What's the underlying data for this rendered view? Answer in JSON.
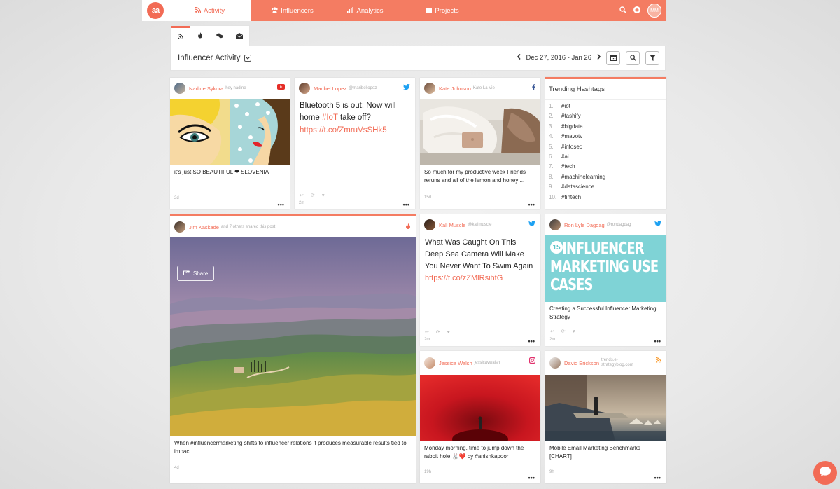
{
  "nav": {
    "logo": "aa",
    "tabs": [
      {
        "label": "Activity",
        "icon": "rss-icon"
      },
      {
        "label": "Influencers",
        "icon": "users-icon"
      },
      {
        "label": "Analytics",
        "icon": "bar-chart-icon"
      },
      {
        "label": "Projects",
        "icon": "folder-icon"
      }
    ],
    "user_initials": "MM"
  },
  "subtabs": [
    "rss-icon",
    "fire-icon",
    "comments-icon",
    "envelope-icon"
  ],
  "header": {
    "title": "Influencer Activity",
    "date_range": "Dec 27, 2016 - Jan 26"
  },
  "cards": {
    "nadine": {
      "name": "Nadine Sykora",
      "handle": "hey nadine",
      "caption": "it's just SO BEAUTIFUL ❤ SLOVENIA",
      "time": "2d"
    },
    "maribel": {
      "name": "Maribel Lopez",
      "handle": "@maribellopez",
      "text": "Bluetooth 5 is out: Now will home ",
      "hashtag": "#IoT",
      "text2": " take off?",
      "link": "https://t.co/ZmruVsSHk5",
      "time": "2m"
    },
    "kate": {
      "name": "Kate Johnson",
      "handle": "Kate La Vie",
      "caption": "So much for my productive week Friends reruns and all of the lemon and honey ...",
      "time": "15d"
    },
    "jim": {
      "name": "Jim Kaskade",
      "handle": "and 7 others shared this post",
      "share": "Share",
      "caption": "When #influencermarketing shifts to influencer relations it produces measurable results tied to impact",
      "time": "4d"
    },
    "kali": {
      "name": "Kali Muscle",
      "handle": "@kalimuscle",
      "text": "What Was Caught On This Deep Sea Camera Will Make You Never Want To Swim Again ",
      "link": "https://t.co/zZMlRsihtG",
      "time": "2m"
    },
    "ron": {
      "name": "Ron Lyle Dagdag",
      "handle": "@rondagdag",
      "image_number": "15",
      "image_text": "INFLUENCER MARKETING USE CASES",
      "caption": "Creating a Successful Influencer Marketing Strategy",
      "time": "2m"
    },
    "jessica": {
      "name": "Jessica Walsh",
      "handle": "jessicavwalsh",
      "caption": "Monday morning, time to jump down the rabbit hole 🐰❤️ by #anishkapoor",
      "time": "19h"
    },
    "david": {
      "name": "David Erickson",
      "handle": "trends.e-strategyblog.com",
      "caption": "Mobile Email Marketing Benchmarks [CHART]",
      "time": "9h"
    }
  },
  "trending": {
    "title": "Trending Hashtags",
    "items": [
      "#iot",
      "#tashify",
      "#bigdata",
      "#mavotv",
      "#infosec",
      "#ai",
      "#tech",
      "#machinelearning",
      "#datascience",
      "#fintech"
    ]
  },
  "colors": {
    "accent": "#f47c62",
    "twitter": "#1da1f2",
    "youtube": "#e52d27"
  }
}
